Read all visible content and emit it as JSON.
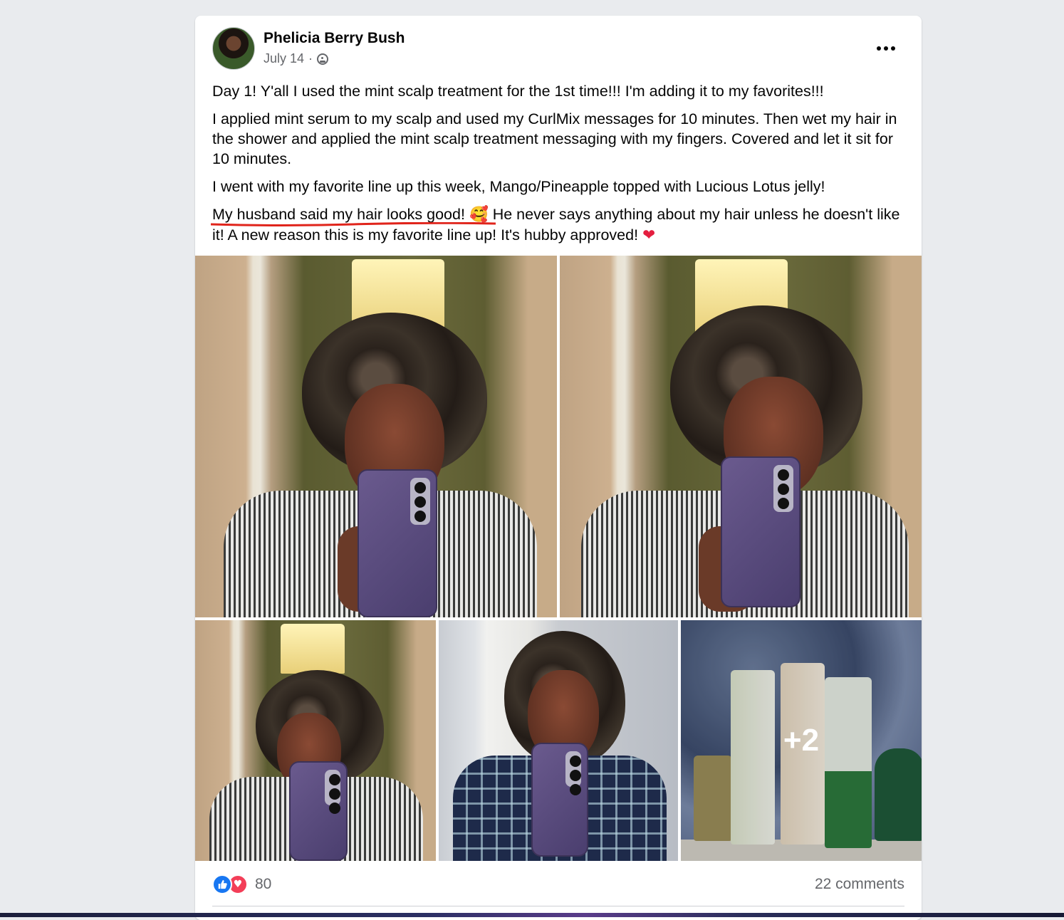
{
  "post": {
    "author": "Phelicia Berry Bush",
    "date": "July 14",
    "separator": "·",
    "privacy_icon": "globe-icon",
    "menu_icon": "more-horizontal-icon"
  },
  "content": {
    "p1": "Day 1! Y'all I used the mint scalp treatment for the 1st time!!! I'm adding it to my favorites!!!",
    "p2": "I applied mint serum to my scalp and used my CurlMix messages for 10 minutes. Then wet my hair in the shower and applied the mint scalp treatment messaging with my fingers. Covered and let it sit for 10 minutes.",
    "p3": "I went with my favorite line up this week, Mango/Pineapple topped with Lucious Lotus jelly!",
    "p4_underlined": "My husband said my hair looks good!",
    "p4_emoji": "🥰",
    "p4_rest": "He never says anything about my hair unless he doesn't like it! A new reason this is my favorite line up! It's hubby approved!",
    "p4_heart": "❤"
  },
  "photos": {
    "extra_count": "+2"
  },
  "footer": {
    "reaction_like_icon": "like-icon",
    "reaction_love_icon": "love-icon",
    "reaction_count": "80",
    "comments": "22 comments"
  },
  "colors": {
    "accent_blue": "#1877f2",
    "love_red": "#f33e58",
    "annotation_red": "#e0241b",
    "secondary_text": "#65676b"
  }
}
